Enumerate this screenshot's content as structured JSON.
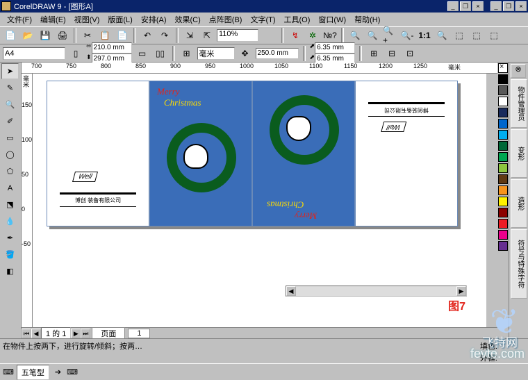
{
  "titlebar": {
    "app": "CorelDRAW 9",
    "doc": "[图形A]"
  },
  "winbtns": {
    "min": "_",
    "max": "❐",
    "close": "×"
  },
  "menu": [
    "文件(F)",
    "编辑(E)",
    "视图(V)",
    "版面(L)",
    "安排(A)",
    "效果(C)",
    "点阵图(B)",
    "文字(T)",
    "工具(O)",
    "窗口(W)",
    "帮助(H)"
  ],
  "toolbar": {
    "zoom": "110%"
  },
  "propbar": {
    "page_size": "A4",
    "width": "210.0 mm",
    "height": "297.0 mm",
    "units": "毫米",
    "nudge": "250.0 mm",
    "dup_x": "6.35 mm",
    "dup_y": "6.35 mm"
  },
  "ruler": {
    "h": [
      "700",
      "750",
      "800",
      "850",
      "900",
      "950",
      "1000",
      "1050",
      "1100",
      "1150",
      "1200",
      "1250",
      "毫米"
    ],
    "v": [
      "毫米",
      "150",
      "100",
      "50",
      "0",
      "-50"
    ]
  },
  "tools": [
    "pick",
    "shape",
    "zoom",
    "freehand",
    "rect",
    "ellipse",
    "polygon",
    "text",
    "interactive",
    "eyedrop",
    "outline",
    "fill"
  ],
  "palette": [
    "none",
    "#000000",
    "#ffffff",
    "#ed1c24",
    "#fff200",
    "#00a651",
    "#00aeef",
    "#2e3192",
    "#ec008c",
    "#898989",
    "#603913",
    "#f7941d",
    "#8dc63f"
  ],
  "rtabs": [
    "物件管理员",
    "变形",
    "造形",
    "符号与特殊字符"
  ],
  "document": {
    "merry": "Merry",
    "christmas": "Christmas",
    "merry2": "Merry",
    "christmas2": "Christmas",
    "brand": "Well",
    "company": "博创 装备有限公司",
    "company2": "博创装备有限公司",
    "label7": "图7"
  },
  "pagebar": {
    "nav": "1 的 1",
    "tab1": "页面",
    "tab2": "1"
  },
  "statusbar": {
    "hint": "在物件上按两下，进行旋转/倾斜；按两…",
    "fill": "填色:",
    "outline": "外框:"
  },
  "taskbar": {
    "ime": "五笔型",
    "ime_icon": "⌨"
  },
  "watermark": {
    "text": "飞特网",
    "url": "fevte.com"
  }
}
